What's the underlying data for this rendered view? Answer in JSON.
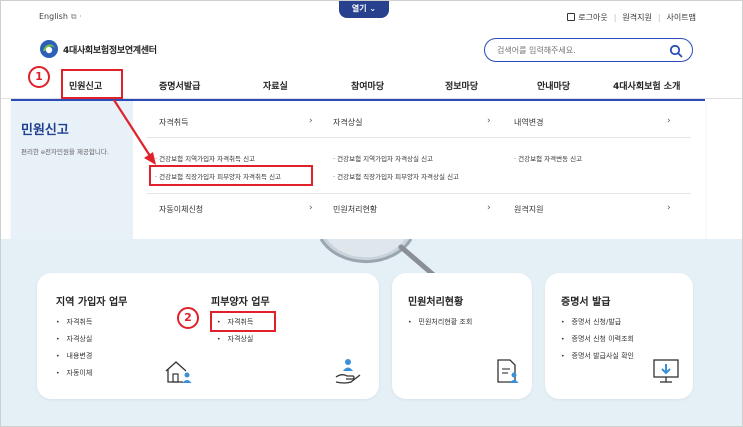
{
  "util": {
    "language": "English",
    "open_button": "열기",
    "logout": "로그아웃",
    "remote_support": "원격지원",
    "sitemap": "사이트맵"
  },
  "header": {
    "logo_text": "4대사회보험정보연계센터",
    "search_placeholder": "검색어를 입력해주세요."
  },
  "gnb": [
    "민원신고",
    "증명서발급",
    "자료실",
    "참여마당",
    "정보마당",
    "안내마당",
    "4대사회보험 소개"
  ],
  "mega": {
    "title": "민원신고",
    "desc": "편리한 e전자민원을 제공합니다.",
    "cat_acquire": "자격취득",
    "cat_lose": "자격상실",
    "cat_change": "내역변경",
    "cat_autopay": "자동이체신청",
    "cat_status": "민원처리현황",
    "cat_remote": "원격지원",
    "sub_acquire_1": "건강보험 지역가입자 자격취득 신고",
    "sub_acquire_2": "건강보험 직장가입자 피부양자 자격취득 신고",
    "sub_lose_1": "건강보험 지역가입자 자격상실 신고",
    "sub_lose_2": "건강보험 직장가입자 피부양자 자격상실 신고",
    "sub_change_1": "건강보험 자격변동 신고"
  },
  "cards": {
    "regional_title": "지역 가입자 업무",
    "regional_items": [
      "자격취득",
      "자격상실",
      "내용변경",
      "자동이체"
    ],
    "dependent_title": "피부양자 업무",
    "dependent_items": [
      "자격취득",
      "자격상실"
    ],
    "status_title": "민원처리현황",
    "status_items": [
      "민원처리현황 조회"
    ],
    "cert_title": "증명서 발급",
    "cert_items": [
      "증명서 신청/발급",
      "증명서 신청 이력조회",
      "증명서 발급사실 확인"
    ]
  },
  "annotations": {
    "step1": "1",
    "step2": "2"
  },
  "colors": {
    "accent": "#2b4cb8",
    "highlight": "#e0212a",
    "menu_title": "#1f3f8f"
  }
}
